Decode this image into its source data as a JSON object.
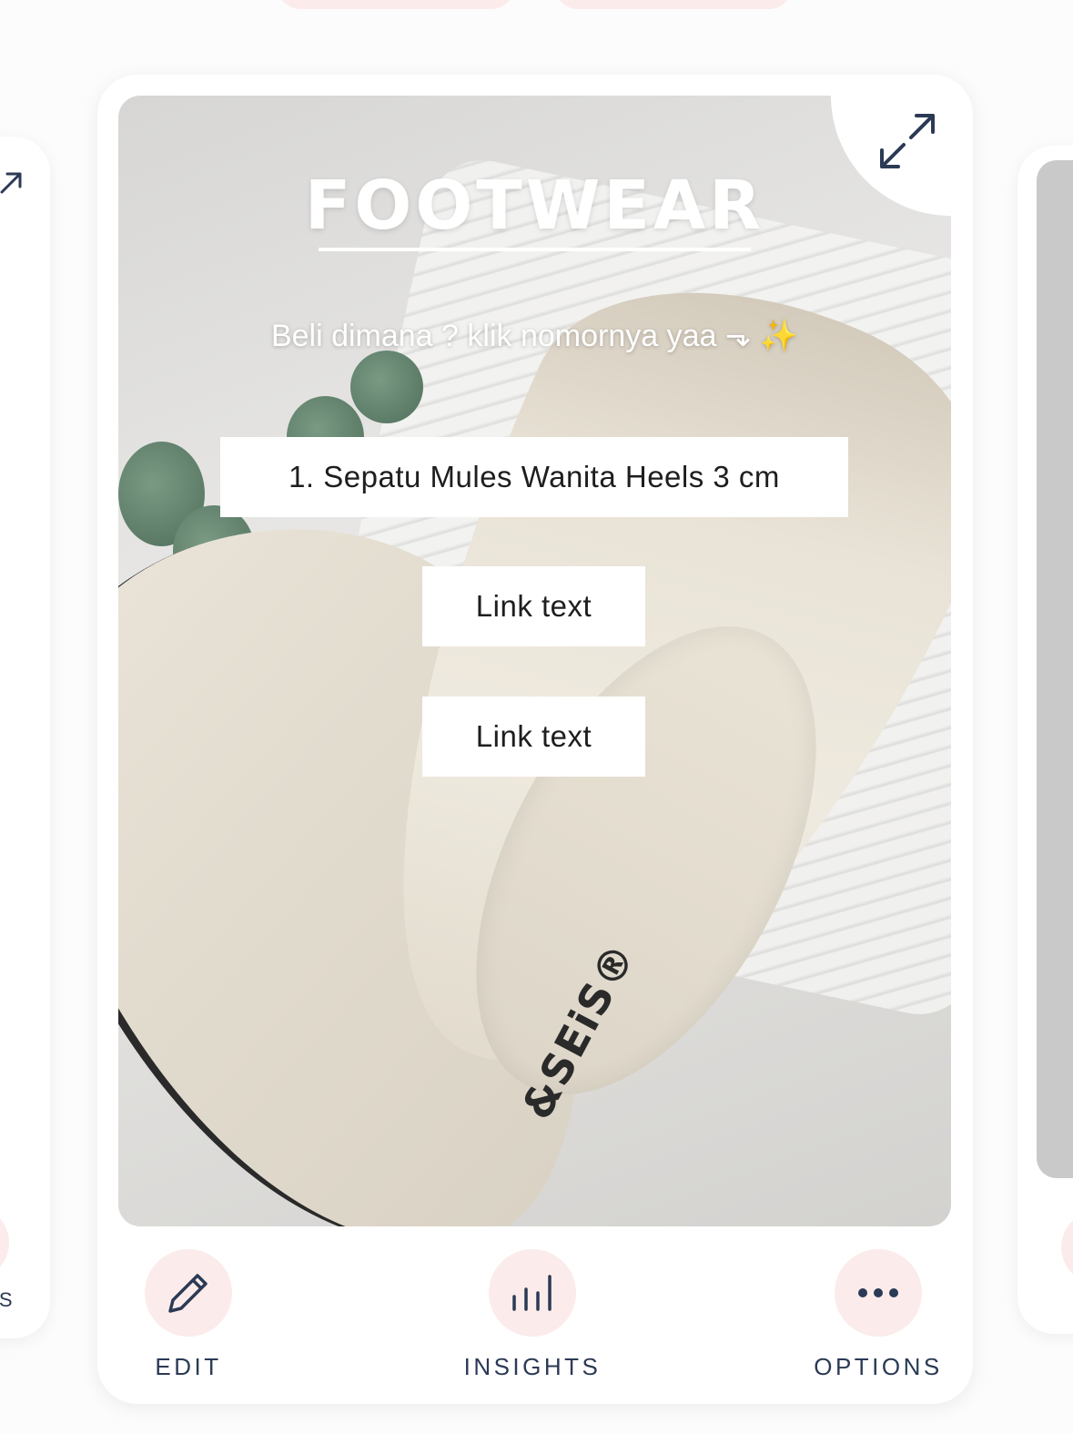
{
  "card": {
    "headline": "FOOTWEAR",
    "subtitle": "Beli dimana ? klik nomornya yaa ⬎ ✨",
    "links": [
      {
        "label": "1. Sepatu Mules Wanita Heels 3 cm"
      },
      {
        "label": "Link text"
      },
      {
        "label": "Link text"
      }
    ],
    "brand_mark": "&SEiS®"
  },
  "actions": {
    "edit": {
      "label": "EDIT",
      "icon": "pencil-icon"
    },
    "insights": {
      "label": "INSIGHTS",
      "icon": "bar-chart-icon"
    },
    "options": {
      "label": "OPTIONS",
      "icon": "more-horizontal-icon"
    }
  },
  "side_left": {
    "label_fragment": "NS",
    "icon": "arrow-up-right-icon"
  },
  "colors": {
    "accent_pink": "#fbeceb",
    "icon_navy": "#2b3a55",
    "card_bg": "#ffffff"
  }
}
